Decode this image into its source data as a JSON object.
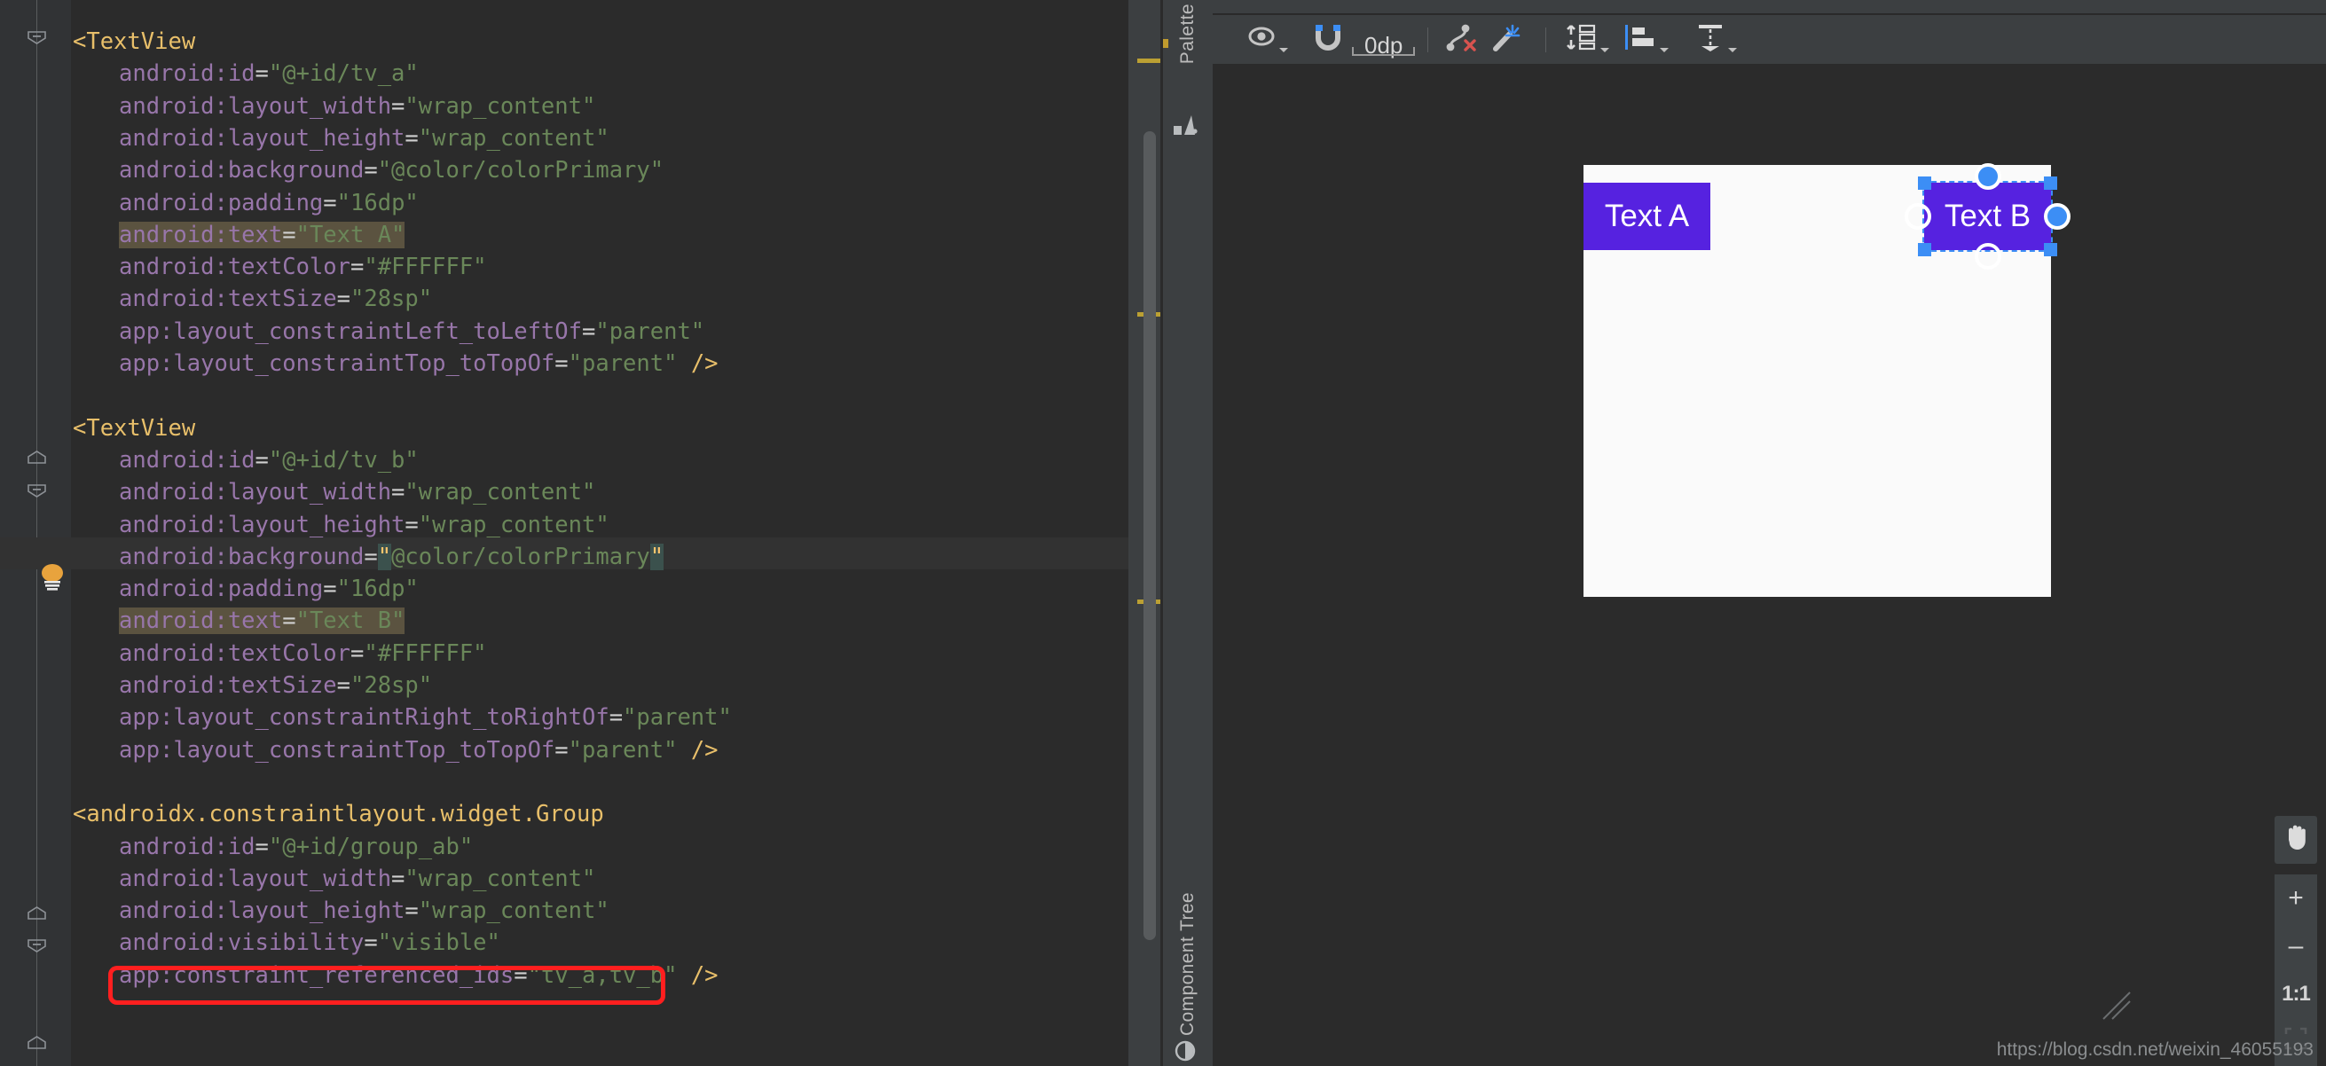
{
  "editor": {
    "lines": [
      {
        "indent": 0,
        "segments": [
          {
            "t": "<TextView",
            "c": "tag"
          }
        ]
      },
      {
        "indent": 1,
        "segments": [
          {
            "t": "android:id",
            "c": "attr"
          },
          {
            "t": "=",
            "c": "eq"
          },
          {
            "t": "\"@+id/tv_a\"",
            "c": "val"
          }
        ]
      },
      {
        "indent": 1,
        "segments": [
          {
            "t": "android:layout_width",
            "c": "attr"
          },
          {
            "t": "=",
            "c": "eq"
          },
          {
            "t": "\"wrap_content\"",
            "c": "val"
          }
        ]
      },
      {
        "indent": 1,
        "segments": [
          {
            "t": "android:layout_height",
            "c": "attr"
          },
          {
            "t": "=",
            "c": "eq"
          },
          {
            "t": "\"wrap_content\"",
            "c": "val"
          }
        ]
      },
      {
        "indent": 1,
        "segments": [
          {
            "t": "android:background",
            "c": "attr"
          },
          {
            "t": "=",
            "c": "eq"
          },
          {
            "t": "\"@color/colorPrimary\"",
            "c": "val"
          }
        ]
      },
      {
        "indent": 1,
        "segments": [
          {
            "t": "android:padding",
            "c": "attr"
          },
          {
            "t": "=",
            "c": "eq"
          },
          {
            "t": "\"16dp\"",
            "c": "val"
          }
        ]
      },
      {
        "indent": 1,
        "highlight": true,
        "segments": [
          {
            "t": "android:text",
            "c": "attr"
          },
          {
            "t": "=",
            "c": "eq"
          },
          {
            "t": "\"Text A\"",
            "c": "val"
          }
        ]
      },
      {
        "indent": 1,
        "segments": [
          {
            "t": "android:textColor",
            "c": "attr"
          },
          {
            "t": "=",
            "c": "eq"
          },
          {
            "t": "\"#FFFFFF\"",
            "c": "val"
          }
        ]
      },
      {
        "indent": 1,
        "segments": [
          {
            "t": "android:textSize",
            "c": "attr"
          },
          {
            "t": "=",
            "c": "eq"
          },
          {
            "t": "\"28sp\"",
            "c": "val"
          }
        ]
      },
      {
        "indent": 1,
        "segments": [
          {
            "t": "app:layout_constraintLeft_toLeftOf",
            "c": "attr"
          },
          {
            "t": "=",
            "c": "eq"
          },
          {
            "t": "\"parent\"",
            "c": "val"
          }
        ]
      },
      {
        "indent": 1,
        "segments": [
          {
            "t": "app:layout_constraintTop_toTopOf",
            "c": "attr"
          },
          {
            "t": "=",
            "c": "eq"
          },
          {
            "t": "\"parent\"",
            "c": "val"
          },
          {
            "t": " ",
            "c": "plain"
          },
          {
            "t": "/>",
            "c": "slash"
          }
        ]
      },
      {
        "indent": 0,
        "segments": []
      },
      {
        "indent": 0,
        "segments": [
          {
            "t": "<TextView",
            "c": "tag"
          }
        ]
      },
      {
        "indent": 1,
        "segments": [
          {
            "t": "android:id",
            "c": "attr"
          },
          {
            "t": "=",
            "c": "eq"
          },
          {
            "t": "\"@+id/tv_b\"",
            "c": "val"
          }
        ]
      },
      {
        "indent": 1,
        "segments": [
          {
            "t": "android:layout_width",
            "c": "attr"
          },
          {
            "t": "=",
            "c": "eq"
          },
          {
            "t": "\"wrap_content\"",
            "c": "val"
          }
        ]
      },
      {
        "indent": 1,
        "segments": [
          {
            "t": "android:layout_height",
            "c": "attr"
          },
          {
            "t": "=",
            "c": "eq"
          },
          {
            "t": "\"wrap_content\"",
            "c": "val"
          }
        ]
      },
      {
        "indent": 1,
        "caret": true,
        "segments": [
          {
            "t": "android:background",
            "c": "attr"
          },
          {
            "t": "=",
            "c": "eq"
          },
          {
            "t": "\"",
            "c": "brace"
          },
          {
            "t": "@color/colorPrimary",
            "c": "val"
          },
          {
            "t": "\"",
            "c": "brace"
          }
        ]
      },
      {
        "indent": 1,
        "segments": [
          {
            "t": "android:padding",
            "c": "attr"
          },
          {
            "t": "=",
            "c": "eq"
          },
          {
            "t": "\"16dp\"",
            "c": "val"
          }
        ]
      },
      {
        "indent": 1,
        "highlight": true,
        "segments": [
          {
            "t": "android:text",
            "c": "attr"
          },
          {
            "t": "=",
            "c": "eq"
          },
          {
            "t": "\"Text B\"",
            "c": "val"
          }
        ]
      },
      {
        "indent": 1,
        "segments": [
          {
            "t": "android:textColor",
            "c": "attr"
          },
          {
            "t": "=",
            "c": "eq"
          },
          {
            "t": "\"#FFFFFF\"",
            "c": "val"
          }
        ]
      },
      {
        "indent": 1,
        "segments": [
          {
            "t": "android:textSize",
            "c": "attr"
          },
          {
            "t": "=",
            "c": "eq"
          },
          {
            "t": "\"28sp\"",
            "c": "val"
          }
        ]
      },
      {
        "indent": 1,
        "segments": [
          {
            "t": "app:layout_constraintRight_toRightOf",
            "c": "attr"
          },
          {
            "t": "=",
            "c": "eq"
          },
          {
            "t": "\"parent\"",
            "c": "val"
          }
        ]
      },
      {
        "indent": 1,
        "segments": [
          {
            "t": "app:layout_constraintTop_toTopOf",
            "c": "attr"
          },
          {
            "t": "=",
            "c": "eq"
          },
          {
            "t": "\"parent\"",
            "c": "val"
          },
          {
            "t": " ",
            "c": "plain"
          },
          {
            "t": "/>",
            "c": "slash"
          }
        ]
      },
      {
        "indent": 0,
        "segments": []
      },
      {
        "indent": 0,
        "segments": [
          {
            "t": "<androidx.constraintlayout.widget.Group",
            "c": "tag"
          }
        ]
      },
      {
        "indent": 1,
        "segments": [
          {
            "t": "android:id",
            "c": "attr"
          },
          {
            "t": "=",
            "c": "eq"
          },
          {
            "t": "\"@+id/group_ab\"",
            "c": "val"
          }
        ]
      },
      {
        "indent": 1,
        "segments": [
          {
            "t": "android:layout_width",
            "c": "attr"
          },
          {
            "t": "=",
            "c": "eq"
          },
          {
            "t": "\"wrap_content\"",
            "c": "val"
          }
        ]
      },
      {
        "indent": 1,
        "segments": [
          {
            "t": "android:layout_height",
            "c": "attr"
          },
          {
            "t": "=",
            "c": "eq"
          },
          {
            "t": "\"wrap_content\"",
            "c": "val"
          }
        ]
      },
      {
        "indent": 1,
        "segments": [
          {
            "t": "android:visibility",
            "c": "attr"
          },
          {
            "t": "=",
            "c": "eq"
          },
          {
            "t": "\"visible\"",
            "c": "val"
          }
        ]
      },
      {
        "indent": 1,
        "segments": [
          {
            "t": "app:constraint_referenced_ids",
            "c": "attr"
          },
          {
            "t": "=",
            "c": "eq"
          },
          {
            "t": "\"tv_a,tv_b\"",
            "c": "val"
          },
          {
            "t": " ",
            "c": "plain"
          },
          {
            "t": "/>",
            "c": "slash"
          }
        ]
      }
    ],
    "gutter": {
      "fold_icons": [
        "fold-minus",
        "fold-end",
        "fold-minus",
        "fold-end",
        "fold-minus",
        "fold-end"
      ],
      "bulb_icon": "lightbulb-intention-icon"
    },
    "marker_bar": {
      "warning_color": "#bba033",
      "marker_count": 3
    },
    "annotation": {
      "shape": "rectangle",
      "color": "#ff1f1f",
      "targets_line": "app:constraint_referenced_ids=\"tv_a,tv_b\" />"
    }
  },
  "tool_tabs": {
    "palette": {
      "label": "Palette",
      "icon": "palette-icon"
    },
    "component_tree": {
      "label": "Component Tree",
      "icon": "component-tree-icon"
    }
  },
  "design_toolbar": {
    "items": [
      {
        "name": "view-options",
        "icon": "eye-icon",
        "has_caret": true
      },
      {
        "name": "autoconnect",
        "icon": "magnet-icon",
        "has_caret": false
      },
      {
        "name": "default-margin",
        "icon": "margin-field",
        "value": "0dp"
      },
      {
        "name": "clear-constraints",
        "icon": "clear-constraints-icon",
        "has_caret": false
      },
      {
        "name": "infer-constraints",
        "icon": "magic-wand-icon",
        "has_caret": false
      },
      {
        "name": "pack",
        "icon": "pack-icon",
        "has_caret": true
      },
      {
        "name": "align",
        "icon": "align-icon",
        "has_caret": true
      },
      {
        "name": "guidelines",
        "icon": "guideline-icon",
        "has_caret": true
      }
    ]
  },
  "design_canvas": {
    "background": "#fafafa",
    "widgets": [
      {
        "name": "tv_a",
        "text": "Text A",
        "color": "#5622e0",
        "selected": false
      },
      {
        "name": "tv_b",
        "text": "Text B",
        "color": "#5622e0",
        "selected": true
      }
    ],
    "selection_color": "#3c8ef5"
  },
  "zoom_controls": {
    "pan_icon": "pan-hand-icon",
    "zoom_in": "+",
    "zoom_out": "–",
    "actual_size": "1:1",
    "fit_icon": "fit-to-screen-icon"
  },
  "watermark": {
    "text": "https://blog.csdn.net/weixin_46055193"
  }
}
